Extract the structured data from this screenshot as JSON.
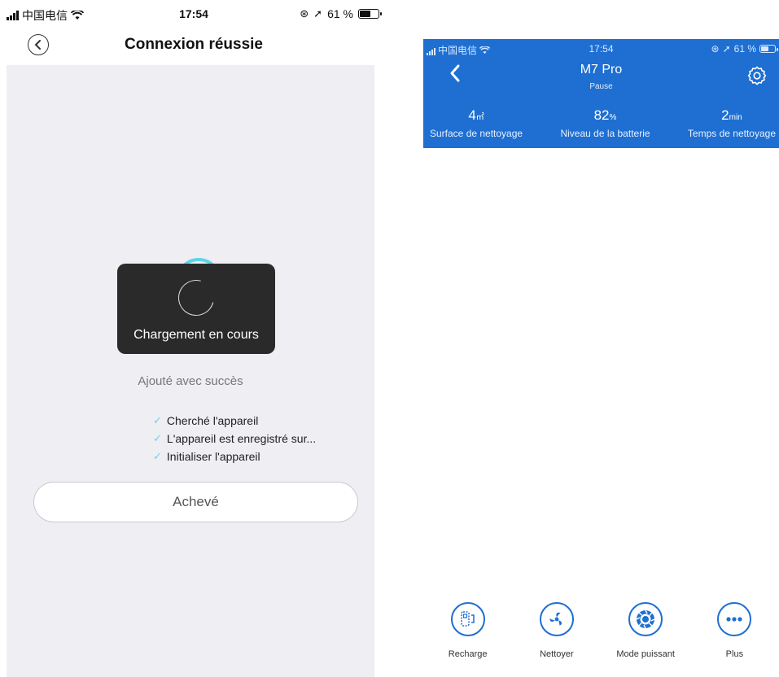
{
  "left": {
    "status_bar": {
      "carrier": "中国电信",
      "time": "17:54",
      "battery": "61 %",
      "battery_level": 0.61
    },
    "nav": {
      "title": "Connexion réussie"
    },
    "toast": {
      "message": "Chargement en cours"
    },
    "added_text": "Ajouté avec succès",
    "steps": [
      {
        "label": "Cherché l'appareil"
      },
      {
        "label": "L'appareil est enregistré sur..."
      },
      {
        "label": "Initialiser l'appareil"
      }
    ],
    "done_button": "Achevé"
  },
  "right": {
    "status_bar": {
      "carrier": "中国电信",
      "time": "17:54",
      "battery": "61 %",
      "battery_level": 0.61
    },
    "nav": {
      "title": "M7 Pro",
      "subtitle": "Pause"
    },
    "stats": [
      {
        "value": "4",
        "unit": "㎡",
        "label": "Surface de nettoyage"
      },
      {
        "value": "82",
        "unit": "%",
        "label": "Niveau de la batterie"
      },
      {
        "value": "2",
        "unit": "min",
        "label": "Temps de nettoyage"
      }
    ],
    "actions": [
      {
        "label": "Recharge",
        "icon": "recharge-icon"
      },
      {
        "label": "Nettoyer",
        "icon": "fan-icon"
      },
      {
        "label": "Mode puissant",
        "icon": "turbo-icon"
      },
      {
        "label": "Plus",
        "icon": "more-icon"
      }
    ]
  },
  "colors": {
    "accent_blue": "#1e6fd1",
    "check_cyan": "#6ecff0",
    "panel_bg": "#eeeef3",
    "toast_bg": "#2a2a2a"
  }
}
